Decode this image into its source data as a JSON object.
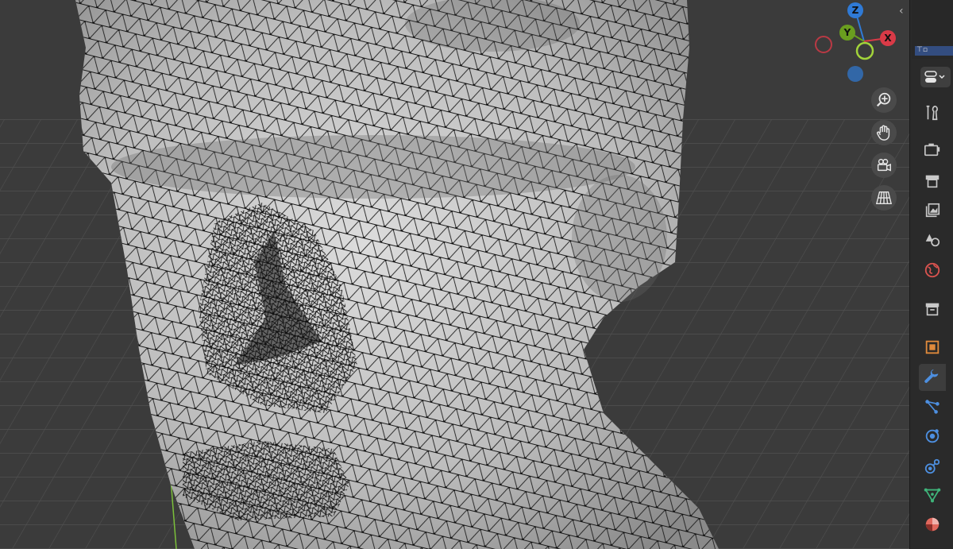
{
  "gizmo": {
    "axes": [
      {
        "label": "Z",
        "color": "#2f7ad6"
      },
      {
        "label": "Y",
        "color": "#6a9e1f"
      },
      {
        "label": "X",
        "color": "#d93a47"
      }
    ]
  },
  "navigation": [
    "zoom-icon",
    "pan-hand-icon",
    "camera-view-icon",
    "perspective-grid-icon"
  ],
  "properties_tabs": [
    {
      "name": "tool",
      "color": "#c9c9c9"
    },
    {
      "name": "render",
      "color": "#c9c9c9"
    },
    {
      "name": "output",
      "color": "#c9c9c9"
    },
    {
      "name": "view-layer",
      "color": "#c9c9c9"
    },
    {
      "name": "scene",
      "color": "#c9c9c9"
    },
    {
      "name": "world",
      "color": "#d9534f"
    },
    {
      "name": "collection",
      "color": "#c9c9c9"
    },
    {
      "name": "object",
      "color": "#e08a3c"
    },
    {
      "name": "modifier",
      "color": "#4d8fe0",
      "active": true
    },
    {
      "name": "particles",
      "color": "#4d8fe0"
    },
    {
      "name": "physics",
      "color": "#4d8fe0"
    },
    {
      "name": "constraints",
      "color": "#4d8fe0"
    },
    {
      "name": "data",
      "color": "#3fb47a"
    },
    {
      "name": "material",
      "color": "#e0675c"
    }
  ]
}
